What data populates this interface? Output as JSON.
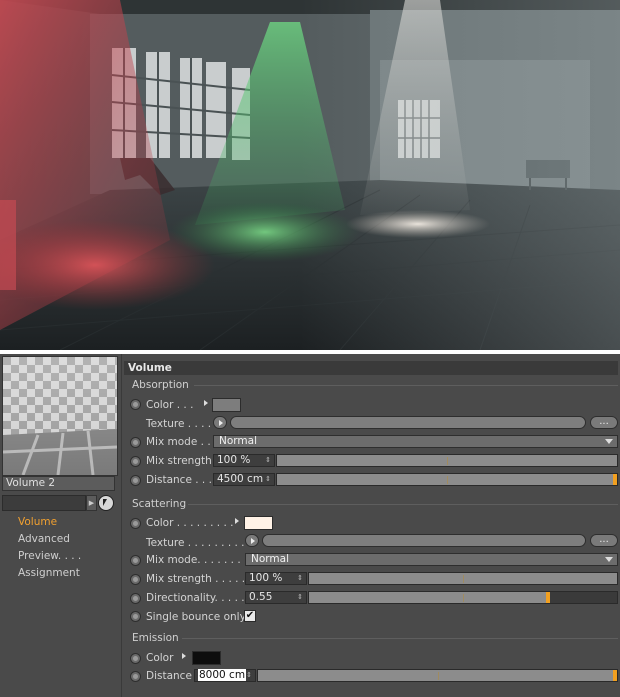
{
  "colors": {
    "absorption_color": "#7d7d7d",
    "scattering_color": "#fff2e6",
    "emission_color": "#0d0d0d",
    "accent": "#f0a030"
  },
  "left_panel": {
    "material_name": "Volume 2",
    "search_value": "",
    "nav_items": [
      {
        "label": "Volume",
        "active": true
      },
      {
        "label": "Advanced",
        "active": false
      },
      {
        "label": "Preview. . . .",
        "active": false
      },
      {
        "label": "Assignment",
        "active": false
      }
    ]
  },
  "panel_title": "Volume",
  "absorption": {
    "section_label": "Absorption",
    "color_label": "Color . . .",
    "texture_label": "Texture . . . . .",
    "mix_mode_label": "Mix mode . . .",
    "mix_mode_value": "Normal",
    "mix_strength_label": "Mix strength",
    "mix_strength_value": "100 %",
    "mix_strength_fraction": 1.0,
    "distance_label": "Distance . . . .",
    "distance_value": "4500 cm",
    "distance_fraction": 1.0
  },
  "scattering": {
    "section_label": "Scattering",
    "color_label": "Color . . . . . . . . .",
    "texture_label": "Texture . . . . . . . . . .",
    "mix_mode_label": "Mix mode. . . . . . . .",
    "mix_mode_value": "Normal",
    "mix_strength_label": "Mix strength . . . . .",
    "mix_strength_value": "100 %",
    "mix_strength_fraction": 1.0,
    "directionality_label": "Directionality. . . . .",
    "directionality_value": "0.55",
    "directionality_fraction": 0.78,
    "single_bounce_label": "Single bounce only",
    "single_bounce_checked": "✔"
  },
  "emission": {
    "section_label": "Emission",
    "color_label": "Color",
    "distance_label": "Distance",
    "distance_value": "8000 cm",
    "distance_fraction": 1.0
  },
  "button_dots": "..."
}
